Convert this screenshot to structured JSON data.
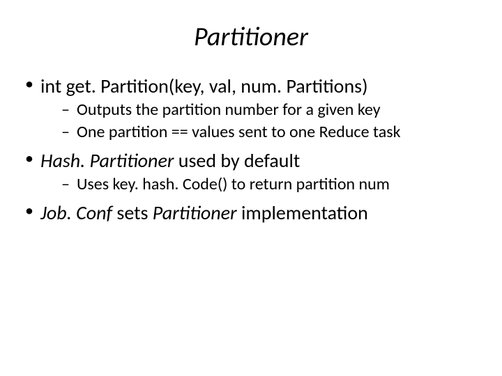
{
  "title": "Partitioner",
  "bullets": [
    {
      "runs": [
        {
          "text": "int get. Partition(key, val, num. Partitions)",
          "italic": false
        }
      ],
      "sub": [
        {
          "text": "Outputs the partition number for a given key"
        },
        {
          "text": "One partition == values sent to one Reduce task"
        }
      ]
    },
    {
      "runs": [
        {
          "text": "Hash. Partitioner",
          "italic": true
        },
        {
          "text": " used by default",
          "italic": false
        }
      ],
      "sub": [
        {
          "text": "Uses key. hash. Code() to return partition num"
        }
      ]
    },
    {
      "runs": [
        {
          "text": "Job. Conf",
          "italic": true
        },
        {
          "text": " sets ",
          "italic": false
        },
        {
          "text": "Partitioner",
          "italic": true
        },
        {
          "text": " implementation",
          "italic": false
        }
      ],
      "sub": []
    }
  ]
}
